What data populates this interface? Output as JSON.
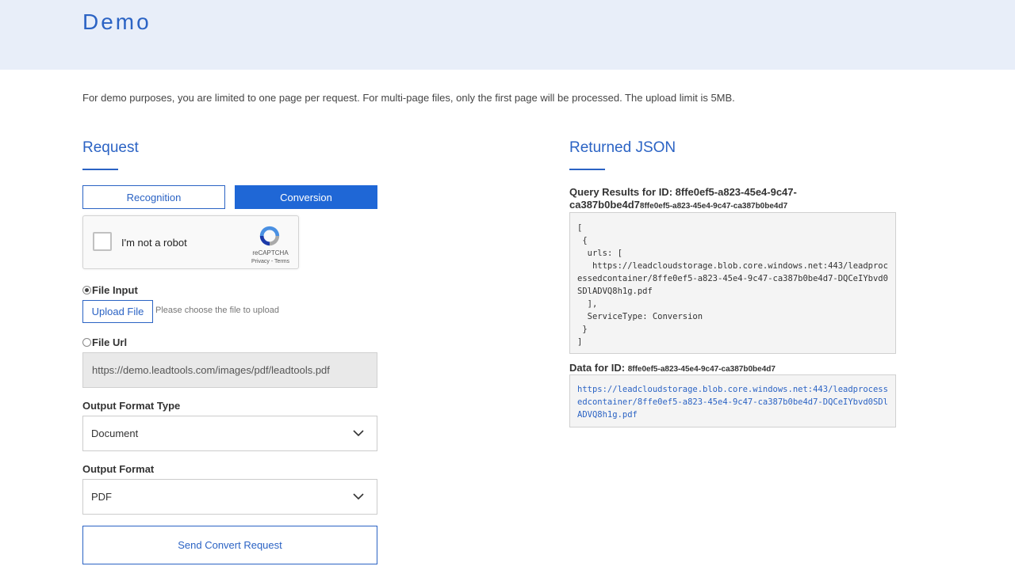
{
  "header": {
    "title": "Demo"
  },
  "notice": "For demo purposes, you are limited to one page per request. For multi-page files, only the first page will be processed. The upload limit is 5MB.",
  "request": {
    "title": "Request",
    "tabs": {
      "recognition": "Recognition",
      "conversion": "Conversion",
      "active": "Conversion"
    },
    "captcha": {
      "label": "I'm not a robot",
      "brand": "reCAPTCHA",
      "links": "Privacy - Terms"
    },
    "file_input": {
      "label": "File Input",
      "selected": true,
      "upload_button": "Upload File",
      "hint": "Please choose the file to upload"
    },
    "file_url": {
      "label": "File Url",
      "selected": false,
      "value": "https://demo.leadtools.com/images/pdf/leadtools.pdf"
    },
    "output_format_type": {
      "label": "Output Format Type",
      "value": "Document"
    },
    "output_format": {
      "label": "Output Format",
      "value": "PDF"
    },
    "send_button": "Send Convert Request"
  },
  "response": {
    "title": "Returned JSON",
    "query_label": "Query Results for ID: 8ffe0ef5-a823-45e4-9c47-ca387b0be4d7",
    "query_id_small": "8ffe0ef5-a823-45e4-9c47-ca387b0be4d7",
    "json_text": "[\n {\n  urls: [\n   https://leadcloudstorage.blob.core.windows.net:443/leadprocessedcontainer/8ffe0ef5-a823-45e4-9c47-ca387b0be4d7-DQCeIYbvd0SDlADVQ8h1g.pdf\n  ],\n  ServiceType: Conversion\n }\n]",
    "data_label": "Data for ID:",
    "data_id": "8ffe0ef5-a823-45e4-9c47-ca387b0be4d7",
    "data_url": "https://leadcloudstorage.blob.core.windows.net:443/leadprocessedcontainer/8ffe0ef5-a823-45e4-9c47-ca387b0be4d7-DQCeIYbvd0SDlADVQ8h1g.pdf"
  },
  "colors": {
    "accent": "#2b63c4",
    "button_fill": "#1f67d6",
    "banner": "#e8eef9"
  }
}
